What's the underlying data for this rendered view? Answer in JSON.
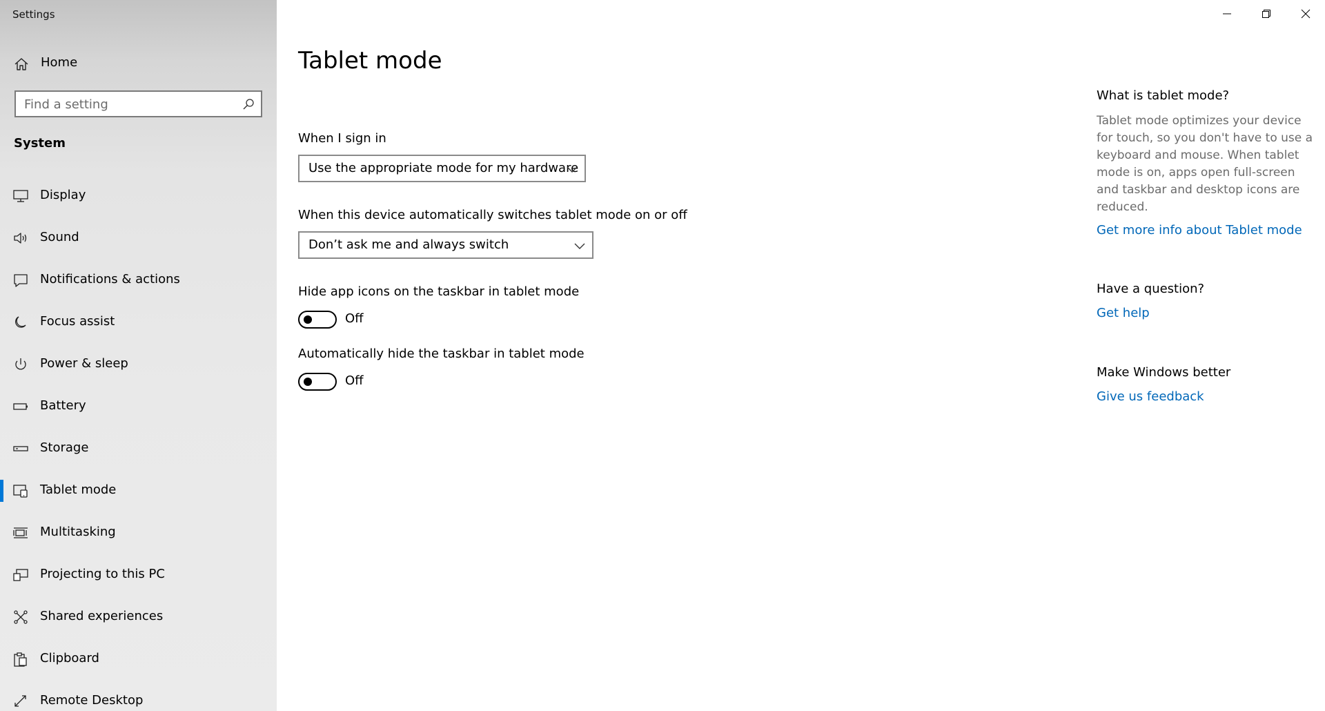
{
  "window": {
    "title": "Settings"
  },
  "sidebar": {
    "home_label": "Home",
    "search": {
      "placeholder": "Find a setting",
      "value": ""
    },
    "section_title": "System",
    "items": [
      {
        "label": "Display",
        "icon": "monitor-icon"
      },
      {
        "label": "Sound",
        "icon": "speaker-icon"
      },
      {
        "label": "Notifications & actions",
        "icon": "notification-icon"
      },
      {
        "label": "Focus assist",
        "icon": "moon-icon"
      },
      {
        "label": "Power & sleep",
        "icon": "power-icon"
      },
      {
        "label": "Battery",
        "icon": "battery-icon"
      },
      {
        "label": "Storage",
        "icon": "storage-icon"
      },
      {
        "label": "Tablet mode",
        "icon": "tablet-mode-icon",
        "selected": true
      },
      {
        "label": "Multitasking",
        "icon": "multitasking-icon"
      },
      {
        "label": "Projecting to this PC",
        "icon": "projecting-icon"
      },
      {
        "label": "Shared experiences",
        "icon": "shared-experiences-icon"
      },
      {
        "label": "Clipboard",
        "icon": "clipboard-icon"
      },
      {
        "label": "Remote Desktop",
        "icon": "remote-desktop-icon"
      }
    ]
  },
  "main": {
    "title": "Tablet mode",
    "sign_in": {
      "label": "When I sign in",
      "selected": "Use the appropriate mode for my hardware"
    },
    "auto_switch": {
      "label": "When this device automatically switches tablet mode on or off",
      "selected": "Don’t ask me and always switch"
    },
    "hide_icons": {
      "label": "Hide app icons on the taskbar in tablet mode",
      "state": "Off"
    },
    "hide_taskbar": {
      "label": "Automatically hide the taskbar in tablet mode",
      "state": "Off"
    }
  },
  "info": {
    "what_heading": "What is tablet mode?",
    "what_body": "Tablet mode optimizes your device for touch, so you don't have to use a keyboard and mouse. When tablet mode is on, apps open full-screen and taskbar and desktop icons are reduced.",
    "what_link": "Get more info about Tablet mode",
    "question_heading": "Have a question?",
    "question_link": "Get help",
    "better_heading": "Make Windows better",
    "better_link": "Give us feedback"
  },
  "colors": {
    "accent": "#0078d7",
    "link": "#0067b8"
  }
}
